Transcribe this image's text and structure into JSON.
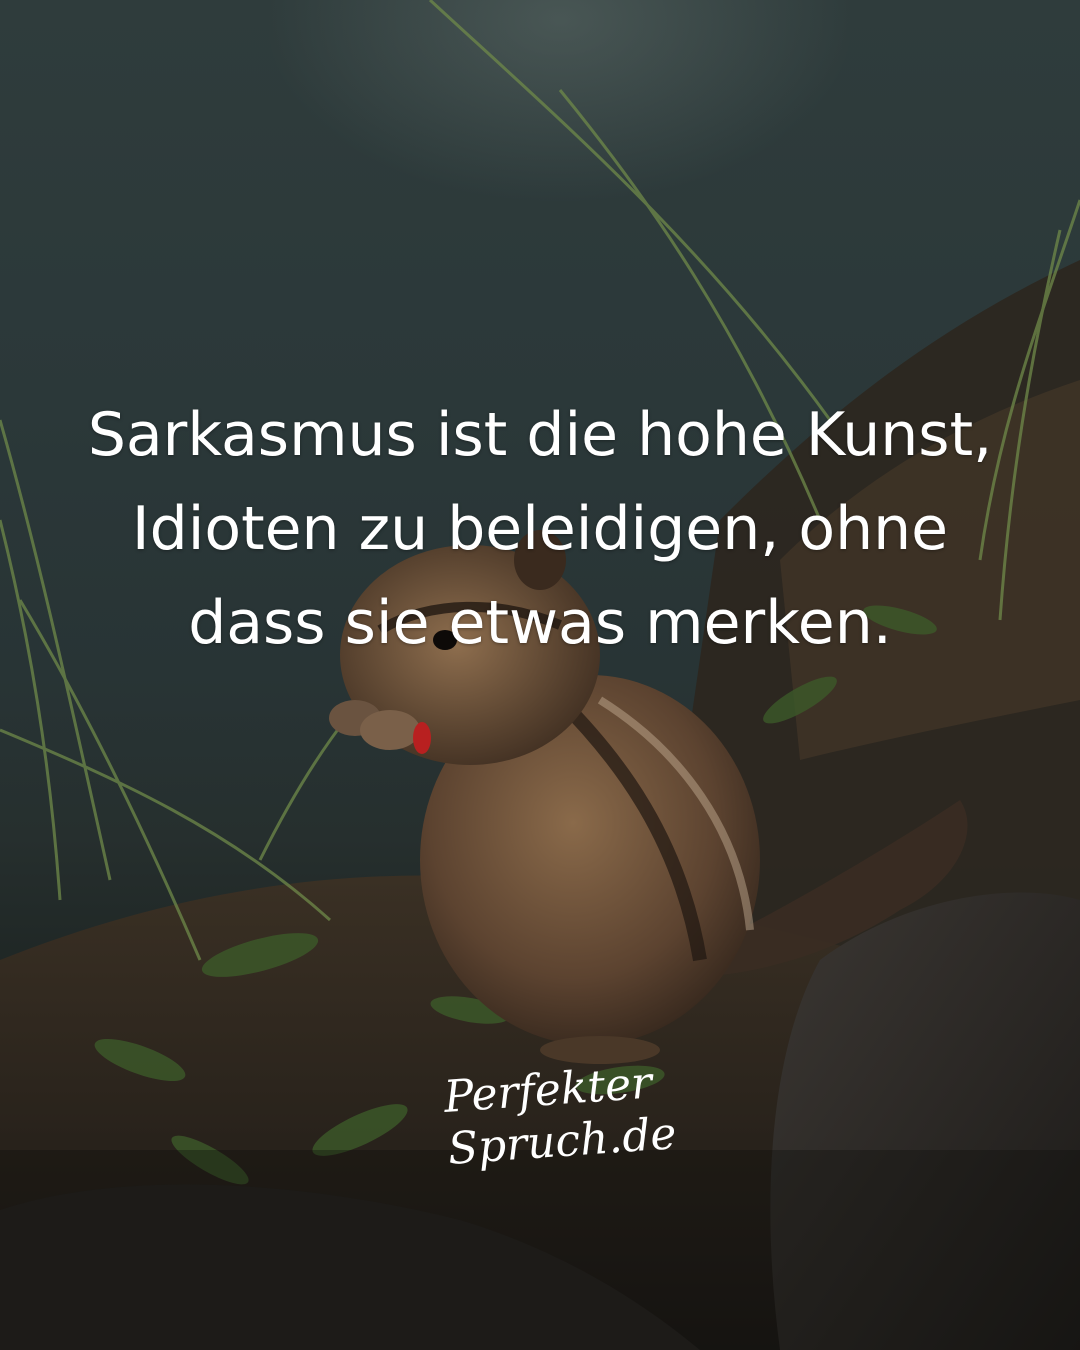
{
  "quote": {
    "lines": [
      "Sarkasmus ist die hohe Kunst,",
      "Idioten zu beleidigen, ohne",
      "dass sie etwas merken."
    ]
  },
  "logo": {
    "line1": "Perfekter",
    "line2": "Spruch.de"
  },
  "colors": {
    "text": "#ffffff",
    "background": "#2b3839"
  }
}
